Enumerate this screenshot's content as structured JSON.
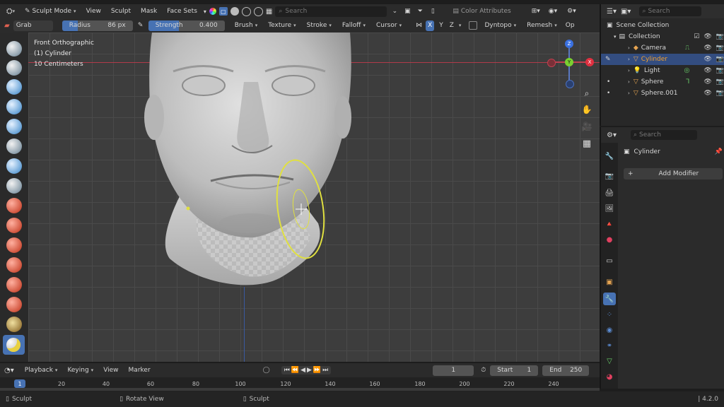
{
  "top": {
    "mode": "Sculpt Mode",
    "menus": [
      "View",
      "Sculpt",
      "Mask",
      "Face Sets"
    ],
    "search_placeholder": "Search",
    "color_attributes": "Color Attributes"
  },
  "tool_header": {
    "brush_name": "Grab",
    "radius_label": "Radius",
    "radius_value": "86 px",
    "strength_label": "Strength",
    "strength_value": "0.400",
    "menus": [
      "Brush",
      "Texture",
      "Stroke",
      "Falloff",
      "Cursor"
    ],
    "axes": [
      "X",
      "Y",
      "Z"
    ],
    "dyntopo": "Dyntopo",
    "remesh": "Remesh",
    "options": "Op"
  },
  "viewport": {
    "view_name": "Front Orthographic",
    "object_name": "(1) Cylinder",
    "scale": "10 Centimeters",
    "gizmo": {
      "z": "Z",
      "y": "Y",
      "x": "X"
    }
  },
  "outliner": {
    "search_placeholder": "Search",
    "scene_collection": "Scene Collection",
    "collection": "Collection",
    "items": [
      {
        "label": "Camera",
        "color": "#e7a552"
      },
      {
        "label": "Cylinder",
        "color": "#e7a552"
      },
      {
        "label": "Light",
        "color": "#e7a552"
      },
      {
        "label": "Sphere",
        "color": "#e7a552"
      },
      {
        "label": "Sphere.001",
        "color": "#e7a552"
      }
    ]
  },
  "properties": {
    "search_placeholder": "Search",
    "object_name": "Cylinder",
    "add_modifier": "Add Modifier"
  },
  "timeline": {
    "menus": [
      "Playback",
      "Keying",
      "View",
      "Marker"
    ],
    "current_frame": "1",
    "start_label": "Start",
    "start_value": "1",
    "end_label": "End",
    "end_value": "250",
    "ticks": [
      "20",
      "40",
      "60",
      "80",
      "100",
      "120",
      "140",
      "160",
      "180",
      "200",
      "220",
      "240"
    ],
    "playhead": "1"
  },
  "status": {
    "left": "Sculpt",
    "middle": "Rotate View",
    "right": "Sculpt",
    "version": "4.2.0"
  },
  "colors": {
    "accent_blue": "#4772b3",
    "active_row": "#334d80",
    "selected_text": "#f0a030",
    "brush_circle": "#e0e040"
  }
}
